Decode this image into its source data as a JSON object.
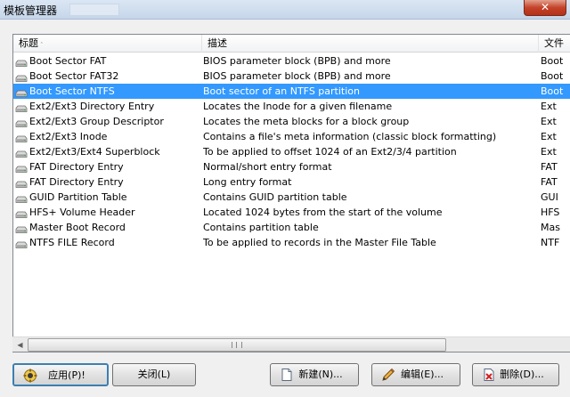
{
  "window": {
    "title": "模板管理器",
    "close_label": "✕"
  },
  "list": {
    "columns": [
      "标题",
      "描述",
      "文件"
    ],
    "rows": [
      {
        "title": "Boot Sector FAT",
        "description": "BIOS parameter block (BPB) and more",
        "file": "Boot"
      },
      {
        "title": "Boot Sector FAT32",
        "description": "BIOS parameter block (BPB) and more",
        "file": "Boot"
      },
      {
        "title": "Boot Sector NTFS",
        "description": "Boot sector of an NTFS partition",
        "file": "Boot",
        "selected": true
      },
      {
        "title": "Ext2/Ext3 Directory Entry",
        "description": "Locates the Inode for a given filename",
        "file": "Ext"
      },
      {
        "title": "Ext2/Ext3 Group Descriptor",
        "description": "Locates the meta blocks for a block group",
        "file": "Ext"
      },
      {
        "title": "Ext2/Ext3 Inode",
        "description": "Contains a file's meta information (classic block formatting)",
        "file": "Ext"
      },
      {
        "title": "Ext2/Ext3/Ext4 Superblock",
        "description": "To be applied to offset 1024 of an Ext2/3/4 partition",
        "file": "Ext"
      },
      {
        "title": "FAT Directory Entry",
        "description": "Normal/short entry format",
        "file": "FAT"
      },
      {
        "title": "FAT Directory Entry",
        "description": "Long entry format",
        "file": "FAT"
      },
      {
        "title": "GUID Partition Table",
        "description": "Contains GUID partition table",
        "file": "GUI"
      },
      {
        "title": "HFS+ Volume Header",
        "description": "Located 1024 bytes from the start of the volume",
        "file": "HFS"
      },
      {
        "title": "Master Boot Record",
        "description": "Contains partition table",
        "file": "Mas"
      },
      {
        "title": "NTFS FILE Record",
        "description": "To be applied to records in the Master File Table",
        "file": "NTF"
      }
    ]
  },
  "buttons": {
    "apply": "应用(P)!",
    "close": "关闭(L)",
    "new": "新建(N)...",
    "edit": "编辑(E)...",
    "delete": "删除(D)..."
  },
  "colors": {
    "selection": "#3399ff",
    "close_button": "#c5432a"
  },
  "icons": {
    "row": "drive-icon",
    "apply": "apply-icon",
    "new": "new-document-icon",
    "edit": "pencil-icon",
    "delete": "delete-icon"
  }
}
